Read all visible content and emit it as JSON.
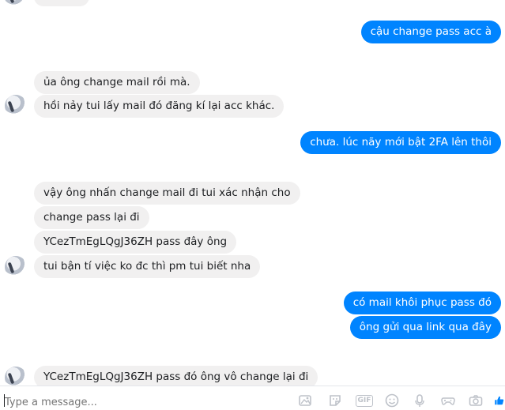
{
  "messages": [
    {
      "id": "m1",
      "side": "out",
      "text": "cậu change pass acc à"
    },
    {
      "id": "m2",
      "side": "in",
      "text": "ủa ông change mail rồi mà."
    },
    {
      "id": "m3",
      "side": "in",
      "text": "hồi nảy tui lấy mail đó đăng kí lại acc khác."
    },
    {
      "id": "m4",
      "side": "out",
      "text": "chưa. lúc nãy mới bật 2FA lên thôi"
    },
    {
      "id": "m5",
      "side": "in",
      "text": "vậy ông nhấn change mail đi tui xác nhận cho"
    },
    {
      "id": "m6",
      "side": "in",
      "text": "change pass lại đi"
    },
    {
      "id": "m7",
      "side": "in",
      "text": "YCezTmEgLQgJ36ZH pass đây ông"
    },
    {
      "id": "m8",
      "side": "in",
      "text": "tui bận tí việc ko đc thì pm tui biết nha"
    },
    {
      "id": "m9",
      "side": "out",
      "text": "có mail khôi phục pass đó"
    },
    {
      "id": "m10",
      "side": "out",
      "text": "ông gửi qua link qua đây"
    },
    {
      "id": "m11",
      "side": "in",
      "text": "YCezTmEgLQgJ36ZH  pass đó ông vô change lại đi"
    }
  ],
  "composer": {
    "placeholder": "Type a message...",
    "gif_label": "GIF",
    "tools": [
      "attach-file-icon",
      "sticker-icon",
      "gif-icon",
      "emoji-icon",
      "microphone-icon",
      "game-icon",
      "camera-icon",
      "like-icon"
    ]
  },
  "colors": {
    "outgoing_bubble": "#0084ff",
    "incoming_bubble": "#f1f0f0",
    "tool_icon": "#bec2c9",
    "like_icon": "#0084ff"
  }
}
